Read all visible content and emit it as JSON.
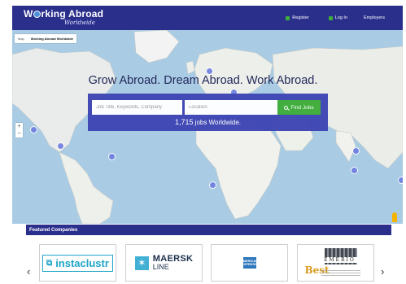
{
  "header": {
    "logo_text_before": "W",
    "logo_text_after": "rking Abroad",
    "logo_sub": "Worldwide",
    "nav": [
      {
        "label": "Register",
        "icon": "register-icon"
      },
      {
        "label": "Log In",
        "icon": "login-icon"
      },
      {
        "label": "Employers"
      }
    ],
    "nav_color": "#2b2f8c",
    "accent_green": "#3fae3a"
  },
  "map": {
    "tabs": [
      "Map",
      "Working Abroad Worldwide"
    ],
    "zoom_in": "+",
    "zoom_out": "−"
  },
  "hero": {
    "title": "Grow Abroad. Dream Abroad. Work Abroad.",
    "keyword_placeholder": "Job Title, Keywords, Company",
    "location_placeholder": "Location",
    "find_label": "Find Jobs",
    "jobs_count": "1,715",
    "jobs_suffix": " jobs Worldwide."
  },
  "featured": {
    "title": "Featured Companies",
    "prev": "‹",
    "next": "›",
    "companies": {
      "instaclustr": "instaclustr",
      "maersk_line1": "MAERSK",
      "maersk_line2": "LINE",
      "amex": "AMERICAN EXPRESS",
      "emerio": "EMERIO",
      "emerio_award": "Best"
    }
  }
}
